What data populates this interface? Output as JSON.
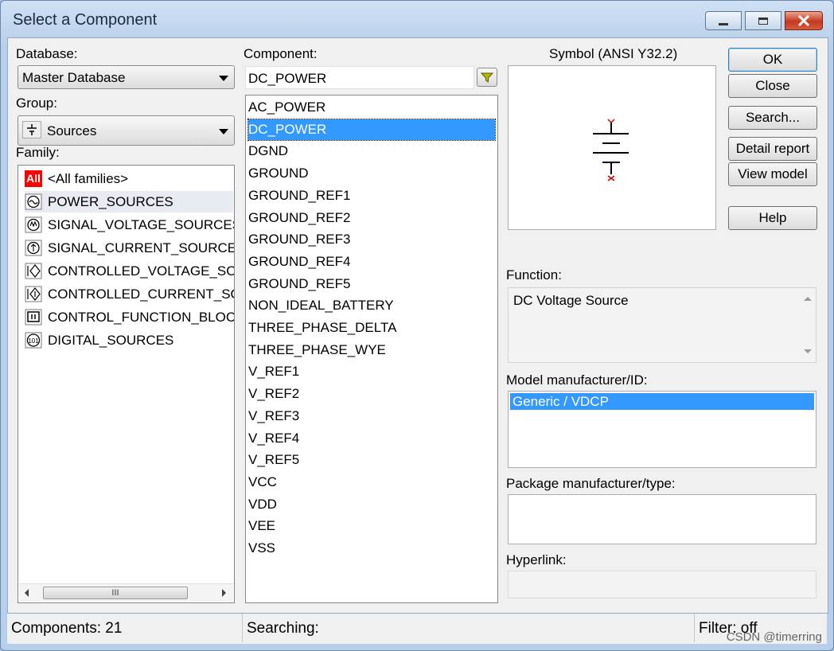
{
  "window": {
    "title": "Select a Component"
  },
  "database": {
    "label": "Database:",
    "value": "Master Database"
  },
  "group": {
    "label": "Group:",
    "value": "Sources",
    "icon": "power-symbol-icon"
  },
  "family": {
    "label": "Family:",
    "items": [
      {
        "icon_text": "All",
        "label": "<All families>"
      },
      {
        "label": "POWER_SOURCES"
      },
      {
        "label": "SIGNAL_VOLTAGE_SOURCES"
      },
      {
        "label": "SIGNAL_CURRENT_SOURCES"
      },
      {
        "label": "CONTROLLED_VOLTAGE_SOUR"
      },
      {
        "label": "CONTROLLED_CURRENT_SOUF"
      },
      {
        "label": "CONTROL_FUNCTION_BLOCKS"
      },
      {
        "label": "DIGITAL_SOURCES"
      }
    ],
    "scroll_grip": "III"
  },
  "component": {
    "label": "Component:",
    "value": "DC_POWER",
    "selected": "DC_POWER",
    "items": [
      "AC_POWER",
      "DC_POWER",
      "DGND",
      "GROUND",
      "GROUND_REF1",
      "GROUND_REF2",
      "GROUND_REF3",
      "GROUND_REF4",
      "GROUND_REF5",
      "NON_IDEAL_BATTERY",
      "THREE_PHASE_DELTA",
      "THREE_PHASE_WYE",
      "V_REF1",
      "V_REF2",
      "V_REF3",
      "V_REF4",
      "V_REF5",
      "VCC",
      "VDD",
      "VEE",
      "VSS"
    ]
  },
  "symbol": {
    "label": "Symbol (ANSI Y32.2)",
    "marker_color": "#d00000"
  },
  "buttons": {
    "ok": "OK",
    "close": "Close",
    "search": "Search...",
    "detail_report": "Detail report",
    "view_model": "View model",
    "help": "Help"
  },
  "function": {
    "label": "Function:",
    "value": "DC Voltage Source"
  },
  "model": {
    "label": "Model manufacturer/ID:",
    "selected": "Generic / VDCP"
  },
  "package": {
    "label": "Package manufacturer/type:"
  },
  "hyperlink": {
    "label": "Hyperlink:"
  },
  "status": {
    "components": "Components: 21",
    "searching": "Searching:",
    "filter": "Filter: off"
  },
  "watermark": "CSDN @timerring",
  "colors": {
    "selection": "#3399ff",
    "all_badge": "#ff0000"
  }
}
